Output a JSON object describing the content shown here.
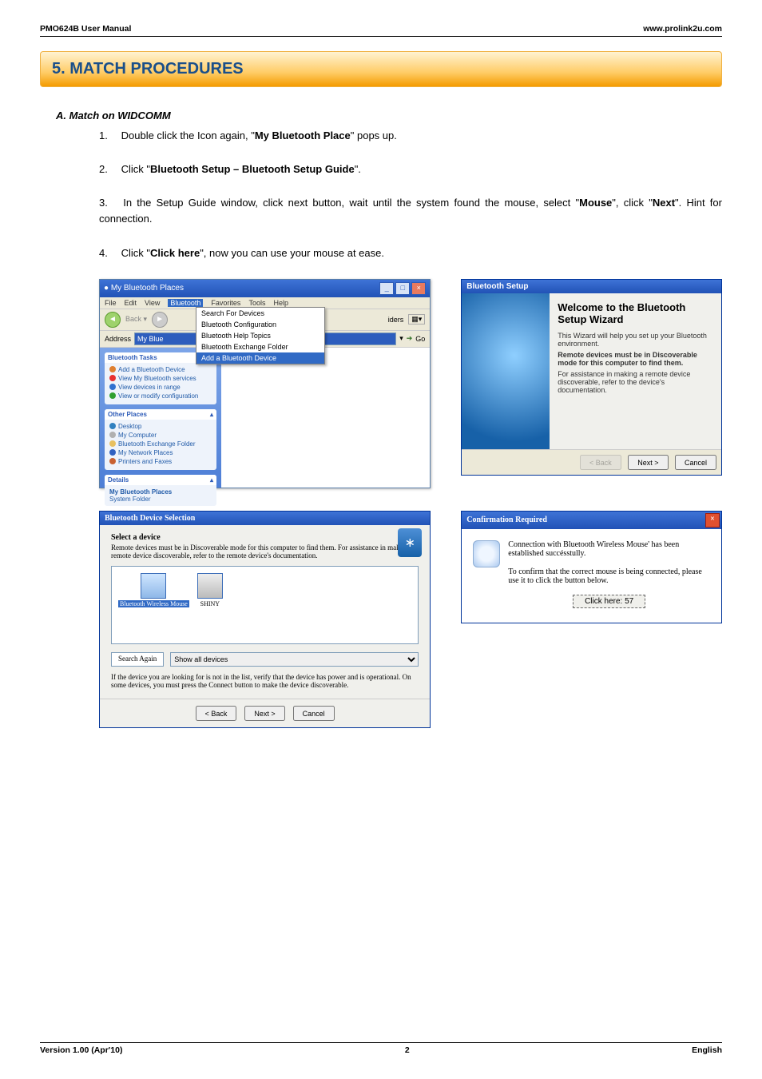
{
  "header": {
    "left": "PMO624B User Manual",
    "right": "www.prolink2u.com"
  },
  "section_banner": "5.  MATCH PROCEDURES",
  "subsection": "A.   Match on WIDCOMM",
  "steps": [
    {
      "n": "1.",
      "pre": "Double click the Icon again, \"",
      "b": "My Bluetooth Place",
      "post": "\" pops up."
    },
    {
      "n": "2.",
      "pre": "Click \"",
      "b": "Bluetooth Setup – Bluetooth Setup Guide",
      "post": "\"."
    },
    {
      "n": "3.",
      "pre": "In the Setup Guide window, click next button, wait until the system found the mouse, select \"",
      "b": "Mouse",
      "mid": "\", click \"",
      "b2": "Next",
      "post": "\". Hint for connection."
    },
    {
      "n": "4.",
      "pre": "Click \"",
      "b": "Click here",
      "post": "\", now you can use your mouse at ease."
    }
  ],
  "mbp": {
    "title": "My Bluetooth Places",
    "menus": [
      "File",
      "Edit",
      "View",
      "Bluetooth",
      "Favorites",
      "Tools",
      "Help"
    ],
    "dropdown": {
      "items": [
        "Search For Devices",
        "Bluetooth Configuration",
        "Bluetooth Help Topics",
        "Bluetooth Exchange Folder"
      ],
      "highlight": "Add a Bluetooth Device"
    },
    "address_label": "Address",
    "address_value": "My Blue",
    "go": "Go",
    "panel_tasks": {
      "head": "Bluetooth Tasks",
      "items": [
        "Add a Bluetooth Device",
        "View My Bluetooth services",
        "View devices in range",
        "View or modify configuration"
      ]
    },
    "panel_places": {
      "head": "Other Places",
      "items": [
        "Desktop",
        "My Computer",
        "Bluetooth Exchange Folder",
        "My Network Places",
        "Printers and Faxes"
      ]
    },
    "panel_details": {
      "head": "Details",
      "line1": "My Bluetooth Places",
      "line2": "System Folder"
    }
  },
  "wizard": {
    "title": "Bluetooth Setup",
    "heading": "Welcome to the Bluetooth Setup Wizard",
    "p1": "This Wizard will help you set up your Bluetooth environment.",
    "p2": "Remote devices must be in Discoverable mode for this computer to find them.",
    "p3": "For assistance in making a remote device discoverable, refer to the device's documentation.",
    "back": "< Back",
    "next": "Next >",
    "cancel": "Cancel"
  },
  "devsel": {
    "title": "Bluetooth Device Selection",
    "h": "Select a device",
    "p1": "Remote devices must be in Discoverable mode for this computer to find them. For assistance in making a remote device discoverable, refer to the remote device's documentation.",
    "dev1": "Bluetooth Wireless Mouse",
    "dev2": "SHINY",
    "search_again": "Search Again",
    "show": "Show all devices",
    "note": "If the device you are looking for is not in the list, verify that the device has power and is operational. On some devices, you must press the Connect button to make the device discoverable.",
    "back": "< Back",
    "next": "Next >",
    "cancel": "Cancel"
  },
  "confirm": {
    "title": "Confirmation Required",
    "p1": "Connection with Bluetooth Wireless Mouse' has been established succésstully.",
    "p2": "To confirm that the correct mouse is being connected, please use it to click the button below.",
    "btn": "Click here: 57"
  },
  "footer": {
    "left": "Version 1.00 (Apr'10)",
    "center": "2",
    "right": "English"
  }
}
